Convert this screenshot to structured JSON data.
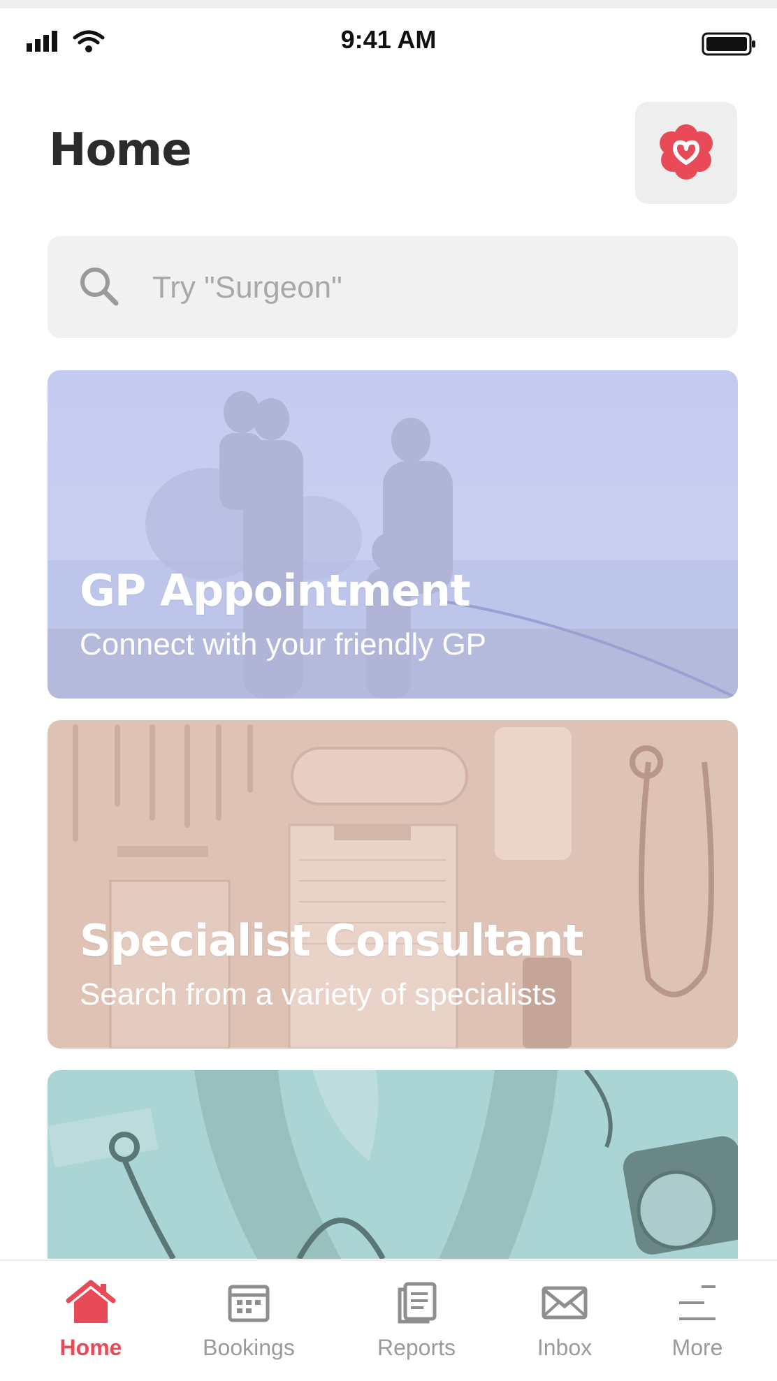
{
  "status_bar": {
    "time": "9:41 AM",
    "icons": [
      "signal-icon",
      "wifi-icon",
      "battery-icon"
    ]
  },
  "header": {
    "title": "Home",
    "logo_icon": "heart-flower-logo-icon"
  },
  "search": {
    "placeholder": "Try \"Surgeon\"",
    "value": "",
    "icon": "search-icon"
  },
  "cards": [
    {
      "title": "GP Appointment",
      "subtitle": "Connect with your friendly GP",
      "tint": "#c5cdee"
    },
    {
      "title": "Specialist Consultant",
      "subtitle": "Search from a variety of specialists",
      "tint": "#dcc0b4"
    },
    {
      "title": "",
      "subtitle": "",
      "tint": "#a9d3d2"
    }
  ],
  "tab_bar": {
    "active": "Home",
    "items": [
      {
        "label": "Home",
        "icon": "home-icon"
      },
      {
        "label": "Bookings",
        "icon": "calendar-icon"
      },
      {
        "label": "Reports",
        "icon": "document-icon"
      },
      {
        "label": "Inbox",
        "icon": "mail-icon"
      },
      {
        "label": "More",
        "icon": "menu-icon"
      }
    ]
  },
  "colors": {
    "accent": "#e84a57",
    "search_background": "#f1f1f1",
    "tab_inactive": "#9a9a9a",
    "title_text": "#2b2b2b"
  }
}
